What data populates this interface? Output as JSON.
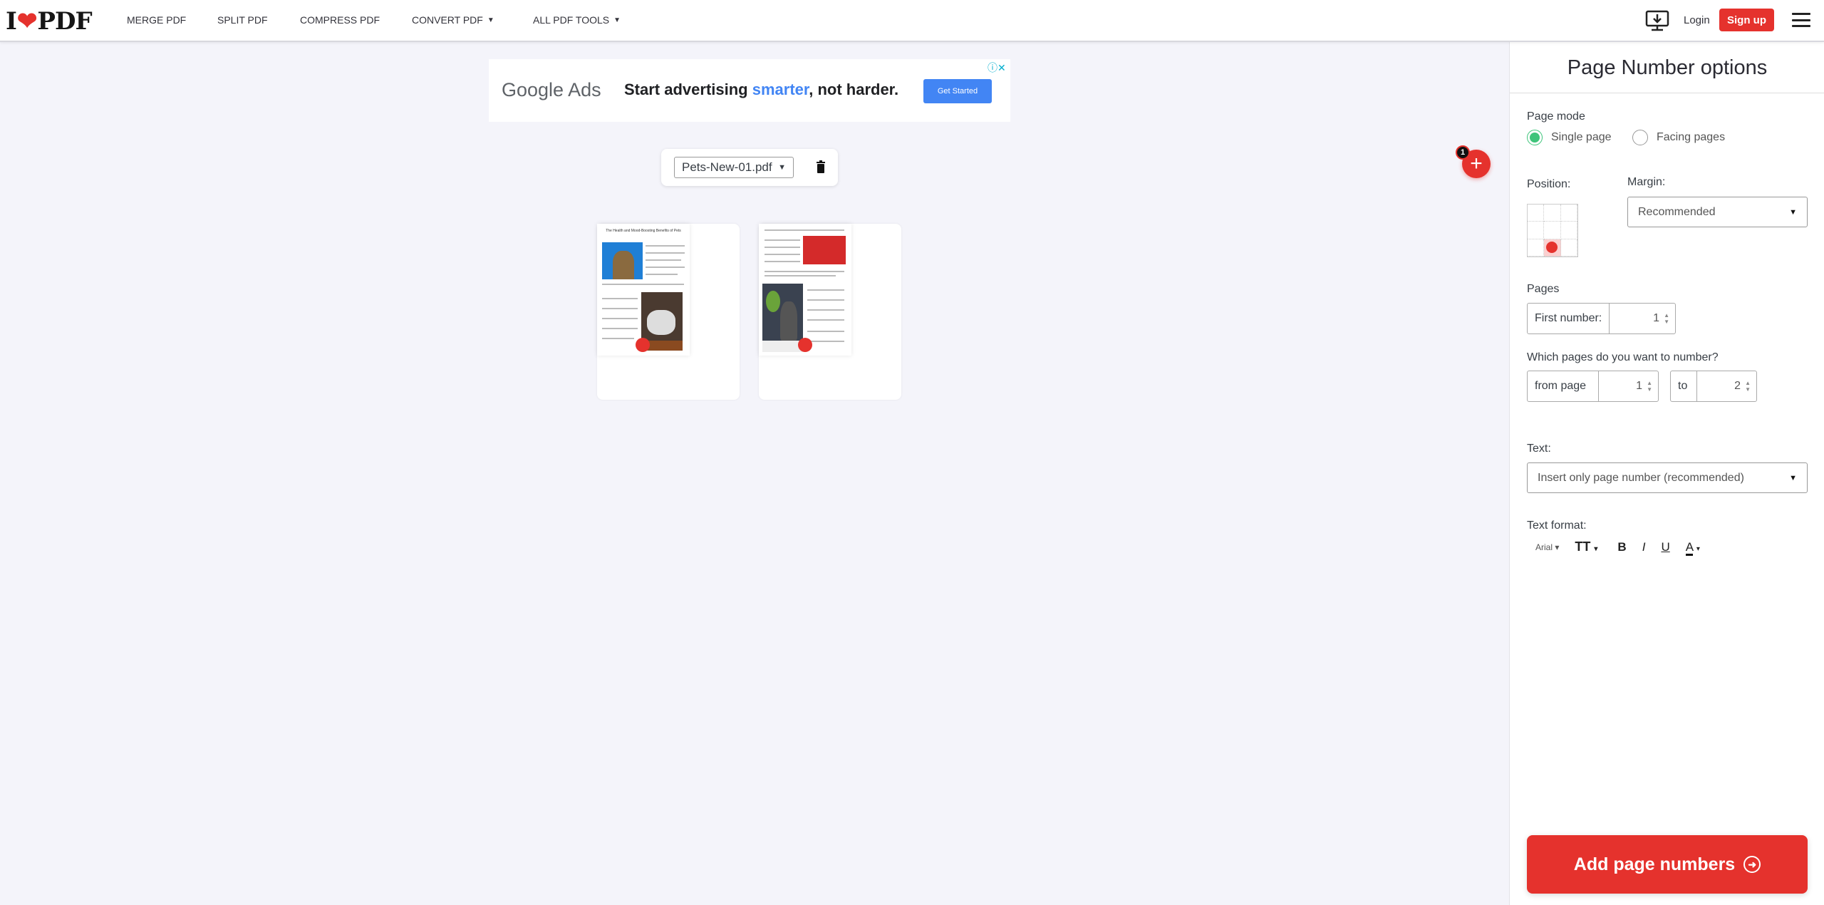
{
  "header": {
    "logo": {
      "prefix": "I",
      "suffix": "PDF"
    },
    "nav": [
      {
        "label": "MERGE PDF"
      },
      {
        "label": "SPLIT PDF"
      },
      {
        "label": "COMPRESS PDF"
      },
      {
        "label": "CONVERT PDF",
        "dropdown": true
      },
      {
        "label": "ALL PDF TOOLS",
        "dropdown": true
      }
    ],
    "login": "Login",
    "signup": "Sign up",
    "icons": [
      "desktop-download-icon",
      "hamburger-menu-icon"
    ]
  },
  "ad": {
    "brand": "Google Ads",
    "headline_pre": "Start advertising ",
    "headline_highlight": "smarter",
    "headline_post": ", not harder.",
    "cta": "Get Started"
  },
  "file": {
    "selected": "Pets-New-01.pdf"
  },
  "pages": [
    {
      "title": "The Health and Mood-Boosting Benefits of Pets"
    },
    {
      "title": ""
    }
  ],
  "add_file": {
    "count": "1"
  },
  "panel": {
    "title": "Page Number options",
    "page_mode": {
      "label": "Page mode",
      "options": [
        "Single page",
        "Facing pages"
      ],
      "selected": "Single page"
    },
    "position": {
      "label": "Position:",
      "selected": "bottom-center"
    },
    "margin": {
      "label": "Margin:",
      "value": "Recommended"
    },
    "pages": {
      "label": "Pages",
      "first_number_label": "First number:",
      "first_number": "1"
    },
    "range": {
      "label": "Which pages do you want to number?",
      "from_label": "from page",
      "from": "1",
      "to_label": "to",
      "to": "2"
    },
    "text": {
      "label": "Text:",
      "value": "Insert only page number (recommended)"
    },
    "text_format": {
      "label": "Text format:",
      "font": "Arial",
      "size_icon": "TT",
      "bold": "B",
      "italic": "I",
      "underline": "U",
      "color": "A"
    },
    "submit": "Add page numbers"
  },
  "colors": {
    "brand": "#e5322d",
    "radio_on": "#3ec47a",
    "ad_blue": "#4285f4"
  }
}
